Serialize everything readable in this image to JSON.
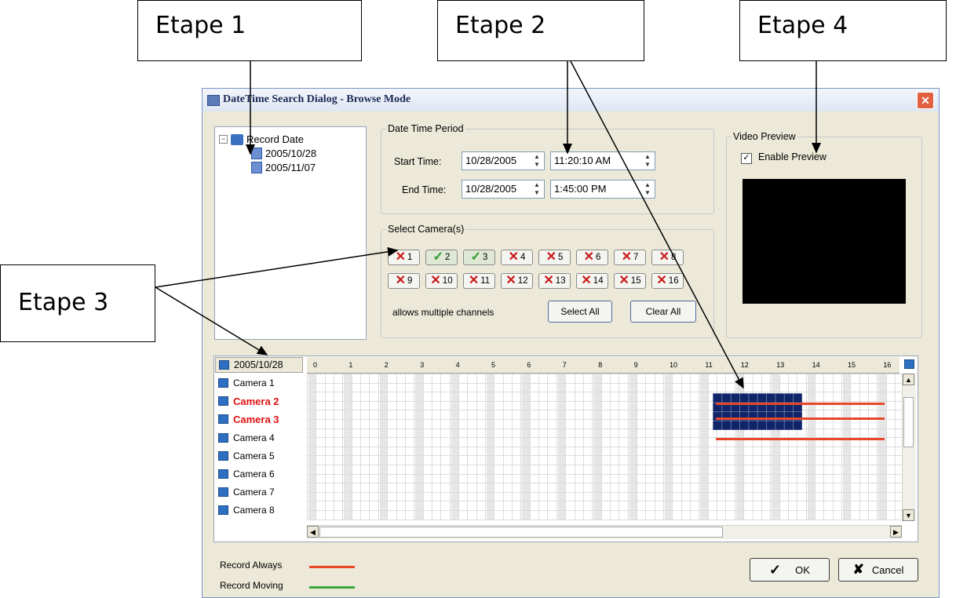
{
  "callouts": {
    "step1": "Etape 1",
    "step2": "Etape 2",
    "step3": "Etape 3",
    "step4": "Etape 4"
  },
  "window": {
    "title": "DateTime Search Dialog - Browse Mode",
    "close_icon": "close-icon"
  },
  "tree": {
    "root_label": "Record Date",
    "dates": [
      "2005/10/28",
      "2005/11/07"
    ]
  },
  "period": {
    "group_label": "Date Time Period",
    "start_label": "Start Time:",
    "start_date": "10/28/2005",
    "start_time": "11:20:10 AM",
    "end_label": "End Time:",
    "end_date": "10/28/2005",
    "end_time": "1:45:00 PM"
  },
  "cameras": {
    "group_label": "Select Camera(s)",
    "buttons": [
      {
        "num": "1",
        "selected": false
      },
      {
        "num": "2",
        "selected": true
      },
      {
        "num": "3",
        "selected": true
      },
      {
        "num": "4",
        "selected": false
      },
      {
        "num": "5",
        "selected": false
      },
      {
        "num": "6",
        "selected": false
      },
      {
        "num": "7",
        "selected": false
      },
      {
        "num": "8",
        "selected": false
      },
      {
        "num": "9",
        "selected": false
      },
      {
        "num": "10",
        "selected": false
      },
      {
        "num": "11",
        "selected": false
      },
      {
        "num": "12",
        "selected": false
      },
      {
        "num": "13",
        "selected": false
      },
      {
        "num": "14",
        "selected": false
      },
      {
        "num": "15",
        "selected": false
      },
      {
        "num": "16",
        "selected": false
      }
    ],
    "hint": "allows multiple channels",
    "select_all": "Select All",
    "clear_all": "Clear All"
  },
  "preview": {
    "group_label": "Video Preview",
    "enable_label": "Enable Preview",
    "enabled": true
  },
  "timeline": {
    "date": "2005/10/28",
    "hours": [
      "0",
      "1",
      "2",
      "3",
      "4",
      "5",
      "6",
      "7",
      "8",
      "9",
      "10",
      "11",
      "12",
      "13",
      "14",
      "15",
      "16"
    ],
    "rows": [
      {
        "label": "Camera 1",
        "highlight": false
      },
      {
        "label": "Camera 2",
        "highlight": true
      },
      {
        "label": "Camera 3",
        "highlight": true
      },
      {
        "label": "Camera 4",
        "highlight": false
      },
      {
        "label": "Camera 5",
        "highlight": false
      },
      {
        "label": "Camera 6",
        "highlight": false
      },
      {
        "label": "Camera 7",
        "highlight": false
      },
      {
        "label": "Camera 8",
        "highlight": false
      }
    ]
  },
  "legend": {
    "record_always": "Record Always",
    "record_always_color": "#e8472a",
    "record_moving": "Record Moving",
    "record_moving_color": "#3aa83a"
  },
  "actions": {
    "ok": "OK",
    "cancel": "Cancel"
  },
  "colors": {
    "selection": "#0f2469",
    "record_line": "#e8472a"
  }
}
